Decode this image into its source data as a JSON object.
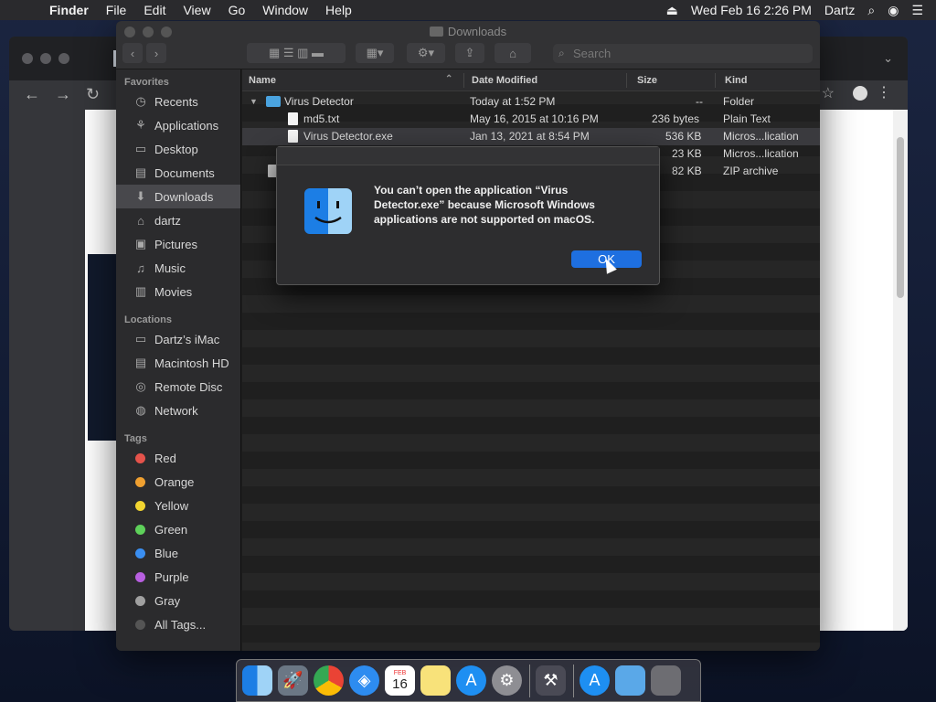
{
  "menubar": {
    "apple_icon": "apple-icon",
    "items": [
      "Finder",
      "File",
      "Edit",
      "View",
      "Go",
      "Window",
      "Help"
    ],
    "date_time": "Wed Feb 16  2:26 PM",
    "user": "Dartz"
  },
  "finder": {
    "title": "Downloads",
    "search_placeholder": "Search",
    "sidebar": {
      "favorites_label": "Favorites",
      "favorites": [
        "Recents",
        "Applications",
        "Desktop",
        "Documents",
        "Downloads",
        "dartz",
        "Pictures",
        "Music",
        "Movies"
      ],
      "locations_label": "Locations",
      "locations": [
        "Dartz’s iMac",
        "Macintosh HD",
        "Remote Disc",
        "Network"
      ],
      "tags_label": "Tags",
      "tags": [
        {
          "name": "Red",
          "color": "#e5534b"
        },
        {
          "name": "Orange",
          "color": "#f0a030"
        },
        {
          "name": "Yellow",
          "color": "#f2d530"
        },
        {
          "name": "Green",
          "color": "#5ed15a"
        },
        {
          "name": "Blue",
          "color": "#3a8ef0"
        },
        {
          "name": "Purple",
          "color": "#b85fe0"
        },
        {
          "name": "Gray",
          "color": "#a0a0a0"
        }
      ],
      "all_tags": "All Tags..."
    },
    "columns": {
      "name": "Name",
      "date": "Date Modified",
      "size": "Size",
      "kind": "Kind"
    },
    "rows": [
      {
        "name": "Virus Detector",
        "date": "Today at 1:52 PM",
        "size": "--",
        "kind": "Folder"
      },
      {
        "name": "md5.txt",
        "date": "May 16, 2015 at 10:16 PM",
        "size": "236 bytes",
        "kind": "Plain Text"
      },
      {
        "name": "Virus Detector.exe",
        "date": "Jan 13, 2021 at 8:54 PM",
        "size": "536 KB",
        "kind": "Micros...lication"
      },
      {
        "name": "",
        "date": "",
        "size": "23 KB",
        "kind": "Micros...lication"
      },
      {
        "name": "",
        "date": "",
        "size": "82 KB",
        "kind": "ZIP archive"
      }
    ]
  },
  "dialog": {
    "message": "You can’t open the application “Virus Detector.exe” because Microsoft Windows applications are not supported on macOS.",
    "ok_label": "OK"
  },
  "calendar_day": "16",
  "calendar_month": "FEB"
}
